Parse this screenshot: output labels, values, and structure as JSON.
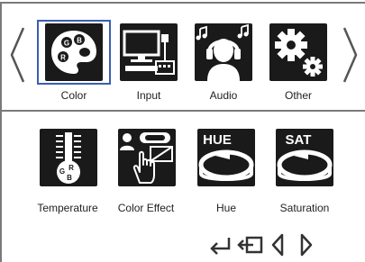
{
  "top_menu": {
    "items": [
      {
        "label": "Color",
        "icon": "palette-icon"
      },
      {
        "label": "Input",
        "icon": "computer-input-icon"
      },
      {
        "label": "Audio",
        "icon": "headphones-icon"
      },
      {
        "label": "Other",
        "icon": "gears-icon"
      }
    ],
    "selected_index": 0
  },
  "sub_menu": {
    "items": [
      {
        "label": "Temperature",
        "icon": "thermometer-rgb-icon"
      },
      {
        "label": "Color Effect",
        "icon": "color-effect-hand-icon"
      },
      {
        "label": "Hue",
        "icon": "hue-icon",
        "icon_text": "HUE"
      },
      {
        "label": "Saturation",
        "icon": "saturation-icon",
        "icon_text": "SAT"
      }
    ]
  },
  "palette_labels": [
    "G",
    "B",
    "R"
  ],
  "thermometer_labels": [
    "G",
    "R",
    "B"
  ],
  "bottom_controls": [
    "enter-icon",
    "exit-icon",
    "left-icon",
    "right-icon"
  ],
  "colors": {
    "selection": "#3a5fb0",
    "icon_bg": "#1a1a1a",
    "frame": "#7a7a7a"
  }
}
